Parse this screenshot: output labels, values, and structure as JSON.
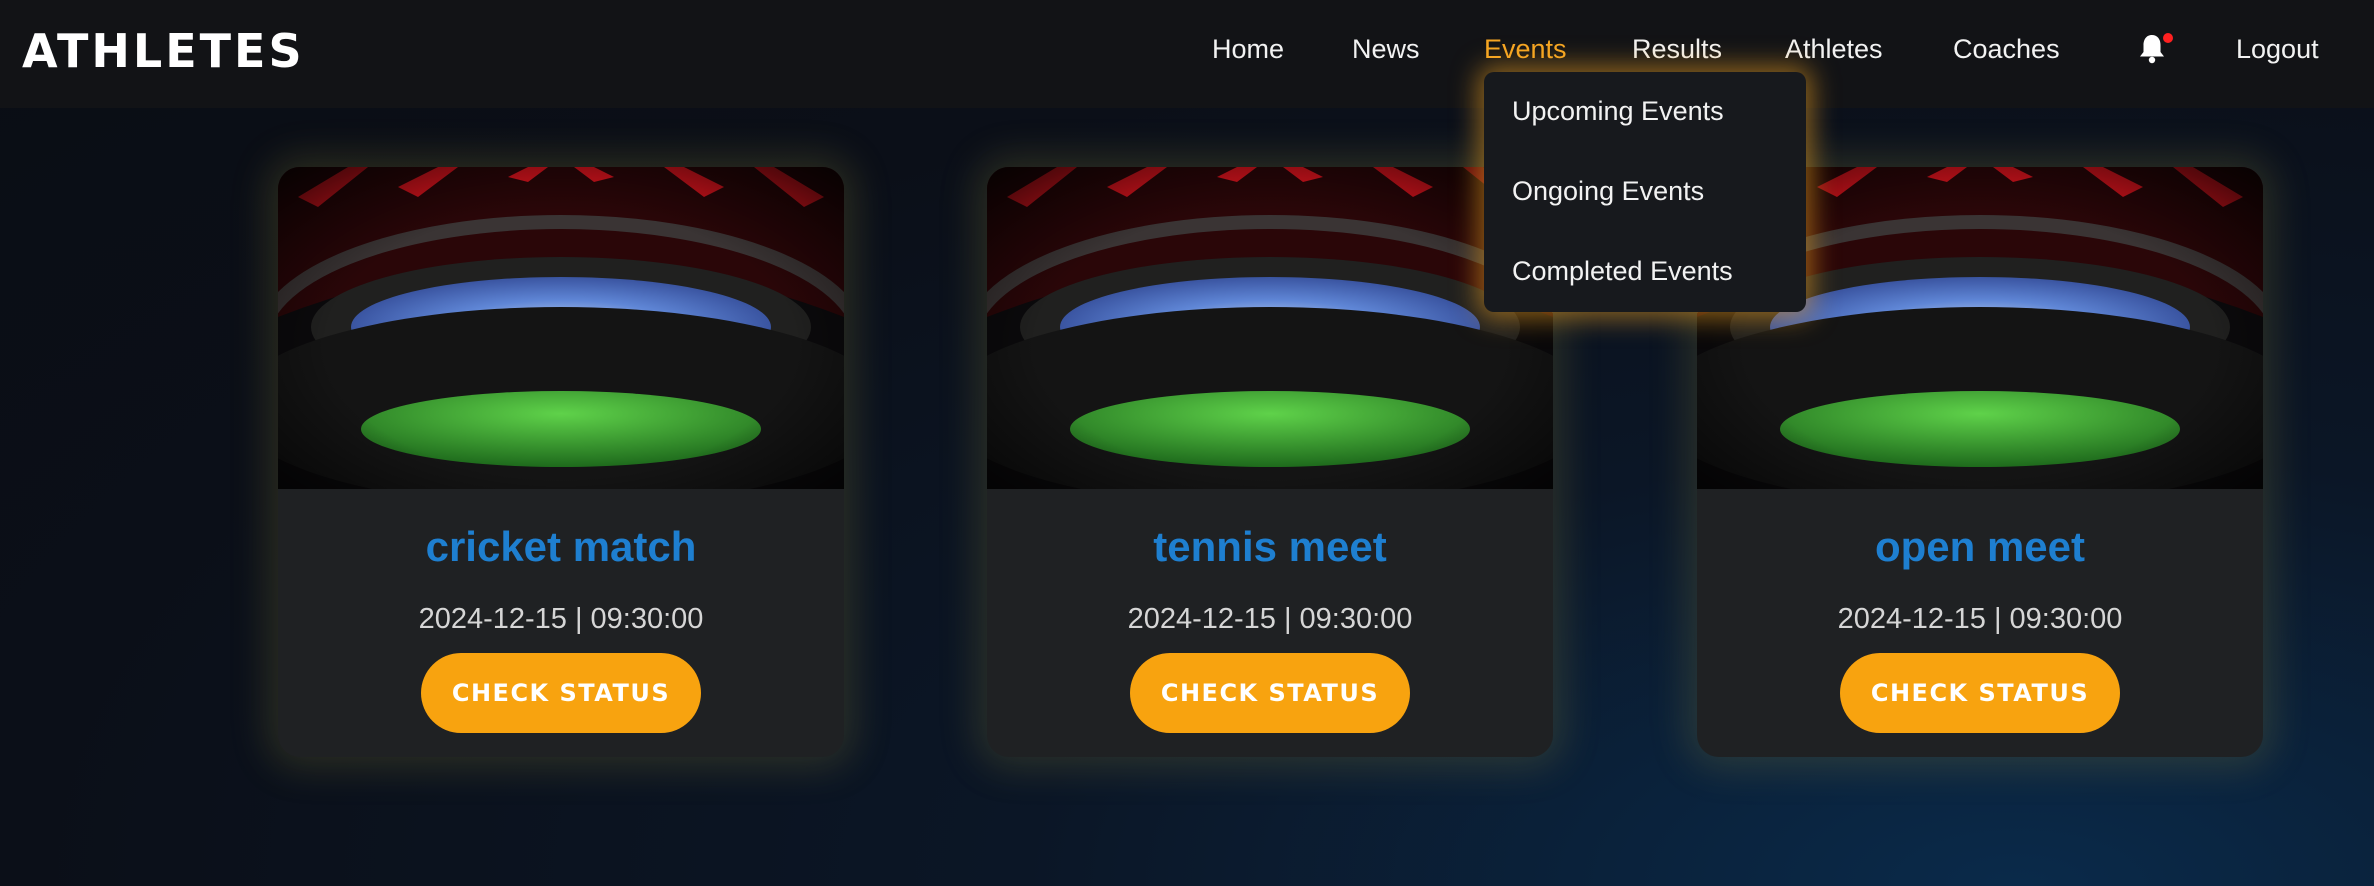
{
  "brand": "ATHLETES",
  "nav": {
    "items": [
      {
        "label": "Home"
      },
      {
        "label": "News"
      },
      {
        "label": "Events",
        "active": true
      },
      {
        "label": "Results"
      },
      {
        "label": "Athletes"
      },
      {
        "label": "Coaches"
      }
    ],
    "notification_icon": "bell-icon",
    "has_notification": true,
    "logout_label": "Logout"
  },
  "events_menu": {
    "items": [
      {
        "label": "Upcoming Events"
      },
      {
        "label": "Ongoing Events"
      },
      {
        "label": "Completed Events"
      }
    ]
  },
  "cards": [
    {
      "title": "cricket match",
      "datetime": "2024-12-15 | 09:30:00",
      "button_label": "CHECK STATUS",
      "image": "stadium-image"
    },
    {
      "title": "tennis meet",
      "datetime": "2024-12-15 | 09:30:00",
      "button_label": "CHECK STATUS",
      "image": "stadium-image"
    },
    {
      "title": "open meet",
      "datetime": "2024-12-15 | 09:30:00",
      "button_label": "CHECK STATUS",
      "image": "stadium-image"
    }
  ],
  "colors": {
    "accent": "#f6a623",
    "button": "#f8a30f",
    "title": "#1e7fd0",
    "notification_dot": "#ff2020",
    "navbar": "#121316",
    "card": "#1f2123"
  }
}
